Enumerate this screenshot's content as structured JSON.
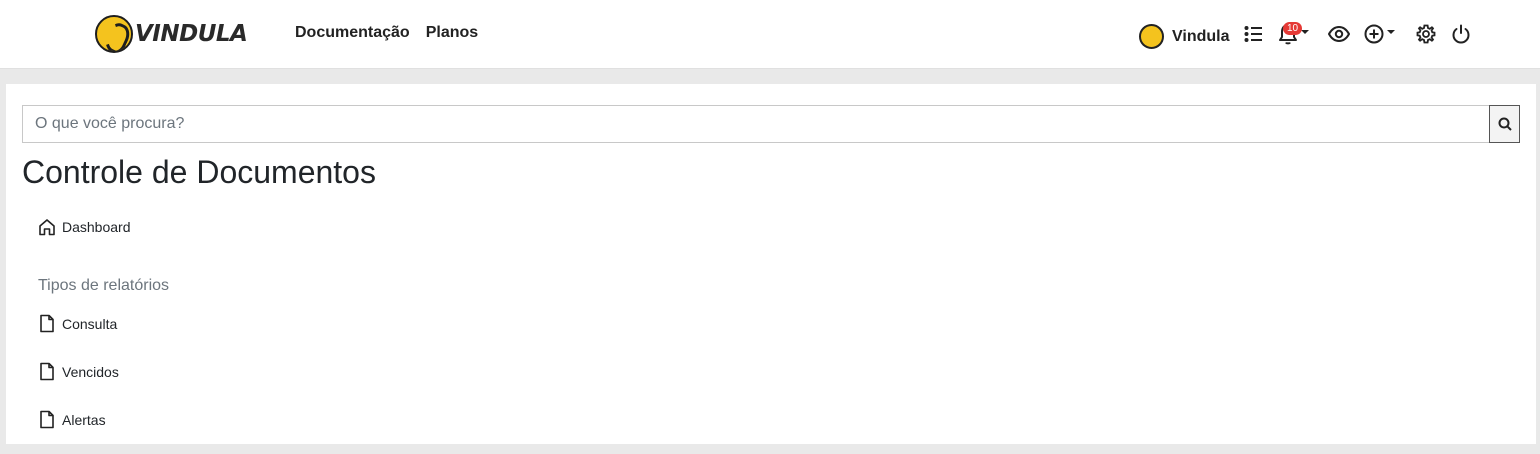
{
  "header": {
    "logo_text": "VINDULA",
    "nav": [
      {
        "label": "Documentação"
      },
      {
        "label": "Planos"
      }
    ],
    "user_name": "Vindula",
    "notification_count": "10",
    "icons": [
      "list-icon",
      "bell-icon",
      "eye-icon",
      "plus-circle-icon",
      "gear-icon",
      "power-icon"
    ]
  },
  "search": {
    "placeholder": "O que você procura?",
    "value": ""
  },
  "page": {
    "title": "Controle de Documentos"
  },
  "menu": {
    "dashboard_label": "Dashboard",
    "section_label": "Tipos de relatórios",
    "items": [
      {
        "label": "Consulta"
      },
      {
        "label": "Vencidos"
      },
      {
        "label": "Alertas"
      }
    ]
  },
  "colors": {
    "background": "#e9e9e9",
    "panel": "#ffffff",
    "brand_yellow": "#f4c31e",
    "badge_red": "#e53935",
    "muted_text": "#6c757d"
  }
}
